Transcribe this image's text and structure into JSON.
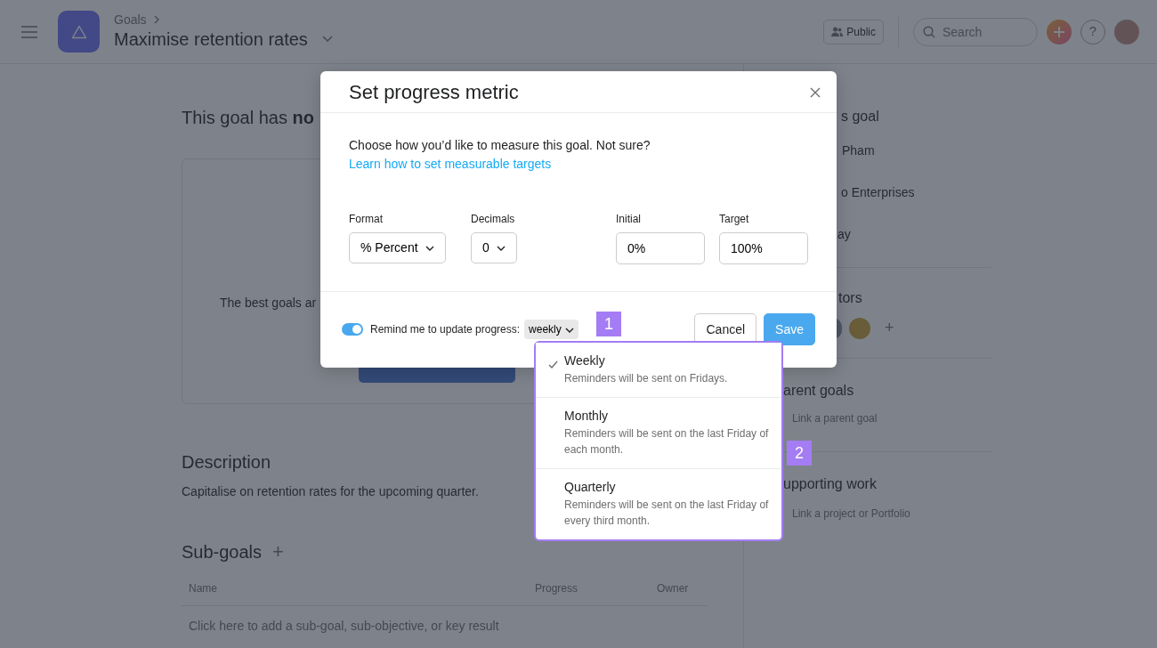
{
  "header": {
    "breadcrumb": "Goals",
    "title": "Maximise retention rates",
    "public_button": "Public",
    "search": {
      "placeholder": "Search"
    },
    "help": "?"
  },
  "goal_status": "This goal has **no**",
  "empty_card_text": "The best goals ar",
  "description": {
    "heading": "Description",
    "text": "Capitalise on retention rates for the upcoming quarter."
  },
  "sub_goals": {
    "heading": "Sub-goals",
    "add": "+",
    "columns": [
      "Name",
      "Progress",
      "Owner"
    ],
    "empty_row": "Click here to add a sub-goal, sub-objective, or key result"
  },
  "sidebar": {
    "about_heading": "s goal",
    "owner": "Pham",
    "team": "o Enterprises",
    "due": "ay",
    "collaborators_heading": "tors",
    "add_collaborator": "+",
    "parent_heading": "arent goals",
    "parent_link": "Link a parent goal",
    "supporting_heading": "upporting work",
    "supporting_link": "Link a project or Portfolio"
  },
  "dialog": {
    "title": "Set progress metric",
    "intro": "Choose how you’d like to measure this goal. Not sure?",
    "intro_link": "Learn how to set measurable targets",
    "fields": [
      {
        "kind": "select",
        "label": "Format",
        "value": "% Percent"
      },
      {
        "kind": "select",
        "label": "Decimals",
        "value": "0"
      },
      {
        "kind": "input",
        "label": "Initial",
        "value": "0%"
      },
      {
        "kind": "input",
        "label": "Target",
        "value": "100%"
      }
    ],
    "reminder": {
      "on": true,
      "label": "Remind me to update progress:",
      "frequency": "weekly"
    },
    "buttons": [
      {
        "kind": "secondary",
        "label": "Cancel"
      },
      {
        "kind": "primary",
        "label": "Save"
      }
    ]
  },
  "frequency_menu": [
    {
      "label": "Weekly",
      "description": "Reminders will be sent on Fridays.",
      "selected": true
    },
    {
      "label": "Monthly",
      "description": "Reminders will be sent on the last Friday of each month.",
      "selected": false
    },
    {
      "label": "Quarterly",
      "description": "Reminders will be sent on the last Friday of every third month.",
      "selected": false
    }
  ],
  "callouts": [
    "1",
    "2"
  ]
}
